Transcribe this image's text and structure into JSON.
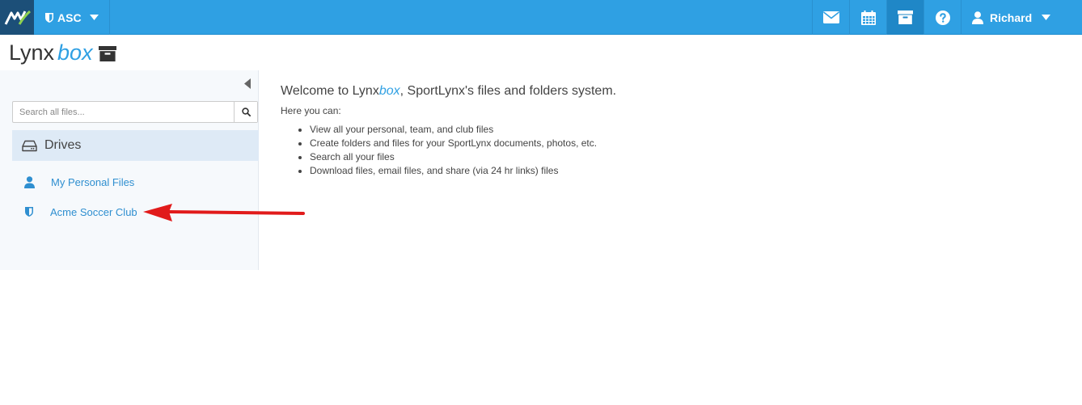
{
  "topbar": {
    "org_label": "ASC",
    "user_name": "Richard",
    "nav_icons": [
      "mail-icon",
      "calendar-icon",
      "archive-icon",
      "help-icon"
    ],
    "active_icon": "archive-icon"
  },
  "app": {
    "title_prefix": "Lynx",
    "title_suffix": "box"
  },
  "sidebar": {
    "search_placeholder": "Search all files...",
    "drives_label": "Drives",
    "items": [
      {
        "label": "My Personal Files",
        "icon": "user-icon"
      },
      {
        "label": "Acme Soccer Club",
        "icon": "shield-icon"
      }
    ]
  },
  "main": {
    "welcome_prefix": "Welcome to Lynx",
    "welcome_box": "box",
    "welcome_suffix": ", SportLynx's files and folders system.",
    "here_you_can": "Here you can:",
    "features": [
      "View all your personal, team, and club files",
      "Create folders and files for your SportLynx documents, photos, etc.",
      "Search all your files",
      "Download files, email files, and share (via 24 hr links) files"
    ]
  },
  "colors": {
    "topbar": "#2fa0e3",
    "logo_bg": "#1c4f78",
    "link": "#2f8fd0",
    "arrow": "#e11b1b"
  }
}
